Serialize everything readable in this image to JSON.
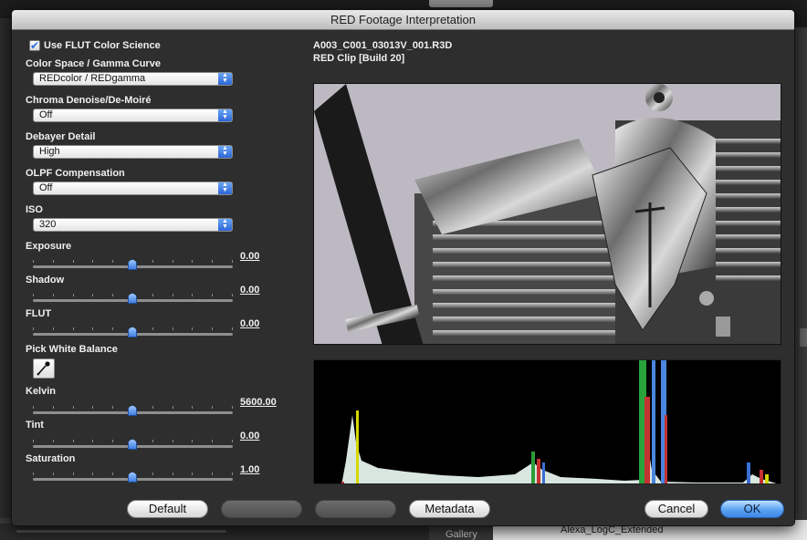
{
  "background": {
    "gallery_label": "Gallery",
    "list_item_label": "Alexa_LogC_Extended"
  },
  "dialog": {
    "title": "RED Footage Interpretation",
    "use_flut": {
      "label": "Use FLUT Color Science",
      "checked": true,
      "check_glyph": "✔"
    },
    "color_space": {
      "label": "Color Space / Gamma Curve",
      "value": "REDcolor / REDgamma"
    },
    "chroma_denoise": {
      "label": "Chroma Denoise/De-Moiré",
      "value": "Off"
    },
    "debayer_detail": {
      "label": "Debayer Detail",
      "value": "High"
    },
    "olpf": {
      "label": "OLPF Compensation",
      "value": "Off"
    },
    "iso": {
      "label": "ISO",
      "value": "320"
    },
    "exposure": {
      "label": "Exposure",
      "value": "0.00",
      "level": 0.5
    },
    "shadow": {
      "label": "Shadow",
      "value": "0.00",
      "level": 0.5
    },
    "flut": {
      "label": "FLUT",
      "value": "0.00",
      "level": 0.5
    },
    "white_balance": {
      "label": "Pick White Balance",
      "icon": "eyedropper-icon"
    },
    "kelvin": {
      "label": "Kelvin",
      "value": "5600.00",
      "level": 0.5
    },
    "tint": {
      "label": "Tint",
      "value": "0.00",
      "level": 0.5
    },
    "saturation": {
      "label": "Saturation",
      "value": "1.00",
      "level": 0.5
    },
    "clip_name": "A003_C001_03013V_001.R3D",
    "clip_info": "RED Clip [Build 20]",
    "buttons": {
      "default": "Default",
      "metadata": "Metadata",
      "cancel": "Cancel",
      "ok": "OK"
    },
    "colors": {
      "accent": "#3d86e6",
      "histogram_bg": "#000000"
    }
  }
}
